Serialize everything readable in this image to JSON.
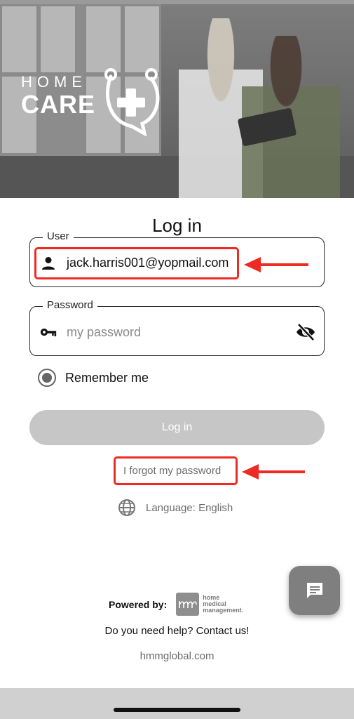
{
  "hero": {
    "logo_top": "HOME",
    "logo_bottom": "CARE"
  },
  "login": {
    "title": "Log in",
    "user_field": {
      "legend": "User",
      "value": "jack.harris001@yopmail.com",
      "icon": "person-icon"
    },
    "password_field": {
      "legend": "Password",
      "placeholder": "my password",
      "icon": "key-icon",
      "toggle_icon": "eye-off-icon"
    },
    "remember_me": {
      "label": "Remember me",
      "selected": true
    },
    "submit_label": "Log in",
    "forgot_label": "I forgot my password",
    "language_label": "Language: English",
    "language_icon": "globe-icon"
  },
  "annotations": {
    "highlight_color": "#ee2a24"
  },
  "footer": {
    "powered_label": "Powered by:",
    "partner_logo_text": [
      "home",
      "medical",
      "management."
    ],
    "help_label": "Do you need help? Contact us!",
    "site_label": "hmmglobal.com",
    "chat_icon": "chat-icon"
  },
  "colors": {
    "accent_disabled": "#c6c6c6",
    "muted_text": "#6c6c6c",
    "fab_background": "#7f7f7f"
  }
}
